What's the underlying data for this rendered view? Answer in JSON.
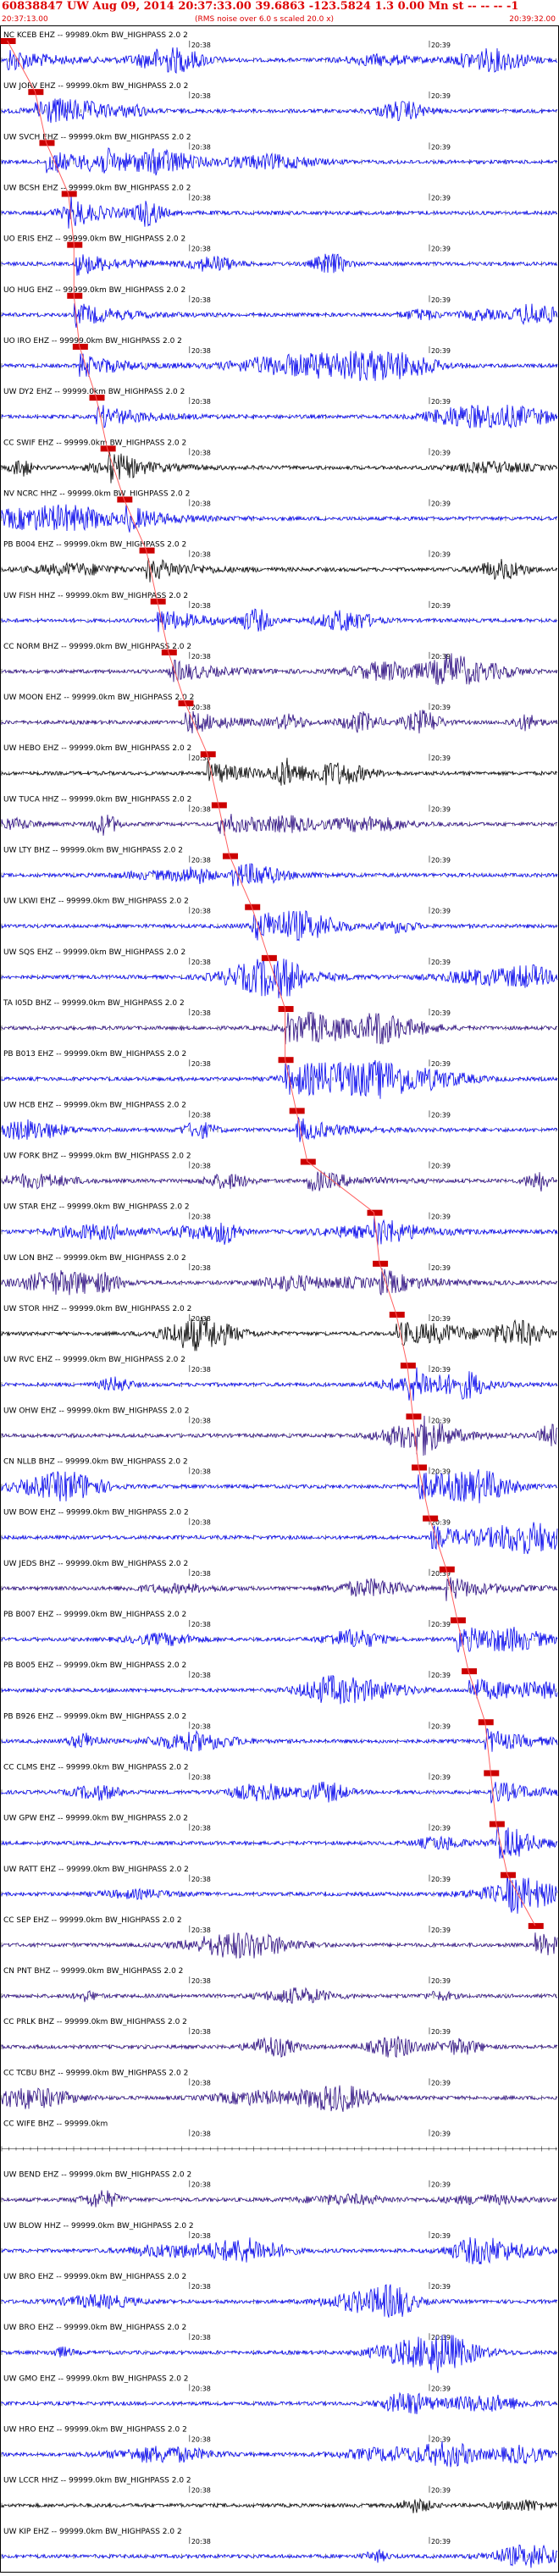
{
  "header": {
    "title": "60838847 UW Aug 09, 2014 20:37:33.00   39.6863 -123.5824  1.3 0.00 Mn st -- -- --  -1",
    "start_time": "20:37:13.00",
    "end_time": "20:39:32.00",
    "note": "(RMS noise over 6.0 s scaled 20.0 x)"
  },
  "colors": {
    "header_red": "#dd0000",
    "pick_red": "#cc0000",
    "pick_line": "#ff6060",
    "trace_blue": "#0000ee",
    "trace_purple": "#2a0a80",
    "trace_black": "#000000"
  },
  "chart_data": {
    "type": "seismogram",
    "time_window": [
      "20:37:13.00",
      "20:39:32.00"
    ],
    "minute_marks": [
      "20:38",
      "20:39"
    ],
    "channels": [
      {
        "label": "NC KCEB EHZ -- 99989.0km BW_HIGHPASS  2.0  2",
        "color": "blue",
        "pick": 0.01
      },
      {
        "label": "UW JORV EHZ -- 99999.0km BW_HIGHPASS  2.0  2",
        "color": "blue",
        "pick": 0.06
      },
      {
        "label": "UW SVCH EHZ -- 99999.0km BW_HIGHPASS  2.0  2",
        "color": "blue",
        "pick": 0.08
      },
      {
        "label": "UW BCSH EHZ -- 99999.0km BW_HIGHPASS  2.0  2",
        "color": "blue",
        "pick": 0.12
      },
      {
        "label": "UO ERIS EHZ -- 99999.0km BW_HIGHPASS  2.0  2",
        "color": "blue",
        "pick": 0.13
      },
      {
        "label": "UO HUG EHZ -- 99999.0km BW_HIGHPASS  2.0  2",
        "color": "blue",
        "pick": 0.13
      },
      {
        "label": "UO IRO EHZ -- 99999.0km BW_HIGHPASS  2.0  2",
        "color": "blue",
        "pick": 0.14
      },
      {
        "label": "UW DY2 EHZ -- 99999.0km BW_HIGHPASS  2.0  2",
        "color": "blue",
        "pick": 0.17
      },
      {
        "label": "CC SWIF EHZ -- 99999.0km BW_HIGHPASS  2.0  2",
        "color": "black",
        "pick": 0.19
      },
      {
        "label": "NV NCRC HHZ -- 99999.0km BW_HIGHPASS  2.0  2",
        "color": "blue",
        "pick": 0.22
      },
      {
        "label": "PB B004 EHZ -- 99999.0km BW_HIGHPASS  2.0  2",
        "color": "black",
        "pick": 0.26
      },
      {
        "label": "UW FISH HHZ -- 99999.0km BW_HIGHPASS  2.0  2",
        "color": "blue",
        "pick": 0.28
      },
      {
        "label": "CC NORM BHZ -- 99999.0km BW_HIGHPASS  2.0  2",
        "color": "purple",
        "pick": 0.3
      },
      {
        "label": "UW MOON EHZ -- 99999.0km BW_HIGHPASS  2.0  2",
        "color": "purple",
        "pick": 0.33
      },
      {
        "label": "UW HEBO EHZ -- 99999.0km BW_HIGHPASS  2.0  2",
        "color": "black",
        "pick": 0.37
      },
      {
        "label": "UW TUCA HHZ -- 99999.0km BW_HIGHPASS  2.0  2",
        "color": "purple",
        "pick": 0.39
      },
      {
        "label": "UW LTY BHZ -- 99999.0km BW_HIGHPASS  2.0  2",
        "color": "blue",
        "pick": 0.41
      },
      {
        "label": "UW LKWI EHZ -- 99999.0km BW_HIGHPASS  2.0  2",
        "color": "blue",
        "pick": 0.45
      },
      {
        "label": "UW SQS EHZ -- 99999.0km BW_HIGHPASS  2.0  2",
        "color": "blue",
        "pick": 0.48
      },
      {
        "label": "TA I05D BHZ -- 99999.0km BW_HIGHPASS  2.0  2",
        "color": "purple",
        "pick": 0.51
      },
      {
        "label": "PB B013 EHZ -- 99999.0km BW_HIGHPASS  2.0  2",
        "color": "blue",
        "pick": 0.51
      },
      {
        "label": "UW HCB EHZ -- 99999.0km BW_HIGHPASS  2.0  2",
        "color": "blue",
        "pick": 0.53
      },
      {
        "label": "UW FORK BHZ -- 99999.0km BW_HIGHPASS  2.0  2",
        "color": "purple",
        "pick": 0.55
      },
      {
        "label": "UW STAR EHZ -- 99999.0km BW_HIGHPASS  2.0  2",
        "color": "blue",
        "pick": 0.67
      },
      {
        "label": "UW LON BHZ -- 99999.0km BW_HIGHPASS  2.0  2",
        "color": "purple",
        "pick": 0.68
      },
      {
        "label": "UW STOR HHZ -- 99999.0km BW_HIGHPASS  2.0  2",
        "color": "black",
        "pick": 0.71
      },
      {
        "label": "UW RVC EHZ -- 99999.0km BW_HIGHPASS  2.0  2",
        "color": "blue",
        "pick": 0.73
      },
      {
        "label": "UW OHW EHZ -- 99999.0km BW_HIGHPASS  2.0  2",
        "color": "purple",
        "pick": 0.74
      },
      {
        "label": "CN NLLB BHZ -- 99999.0km BW_HIGHPASS  2.0  2",
        "color": "blue",
        "pick": 0.75
      },
      {
        "label": "UW BOW EHZ -- 99999.0km BW_HIGHPASS  2.0  2",
        "color": "blue",
        "pick": 0.77
      },
      {
        "label": "UW JEDS BHZ -- 99999.0km BW_HIGHPASS  2.0  2",
        "color": "purple",
        "pick": 0.8
      },
      {
        "label": "PB B007 EHZ -- 99999.0km BW_HIGHPASS  2.0  2",
        "color": "blue",
        "pick": 0.82
      },
      {
        "label": "PB B005 EHZ -- 99999.0km BW_HIGHPASS  2.0  2",
        "color": "blue",
        "pick": 0.84
      },
      {
        "label": "PB B926 EHZ -- 99999.0km BW_HIGHPASS  2.0  2",
        "color": "blue",
        "pick": 0.87
      },
      {
        "label": "CC CLMS EHZ -- 99999.0km BW_HIGHPASS  2.0  2",
        "color": "blue",
        "pick": 0.88
      },
      {
        "label": "UW GPW EHZ -- 99999.0km BW_HIGHPASS  2.0  2",
        "color": "blue",
        "pick": 0.89
      },
      {
        "label": "UW RATT EHZ -- 99999.0km BW_HIGHPASS  2.0  2",
        "color": "blue",
        "pick": 0.91
      },
      {
        "label": "CC SEP EHZ -- 99999.0km BW_HIGHPASS  2.0  2",
        "color": "purple",
        "pick": 0.96
      },
      {
        "label": "CN PNT BHZ -- 99999.0km BW_HIGHPASS  2.0  2",
        "color": "purple",
        "pick": null
      },
      {
        "label": "CC PRLK BHZ -- 99999.0km BW_HIGHPASS  2.0  2",
        "color": "purple",
        "pick": null
      },
      {
        "label": "CC TCBU BHZ -- 99999.0km BW_HIGHPASS  2.0  2",
        "color": "purple",
        "pick": null
      },
      {
        "label": "CC WIFE BHZ -- 99999.0km",
        "color": "none",
        "pick": null
      },
      {
        "label": "UW BEND EHZ -- 99999.0km BW_HIGHPASS  2.0  2",
        "color": "purple",
        "pick": null
      },
      {
        "label": "UW BLOW HHZ -- 99999.0km BW_HIGHPASS  2.0  2",
        "color": "blue",
        "pick": null
      },
      {
        "label": "UW BRO EHZ -- 99999.0km BW_HIGHPASS  2.0  2",
        "color": "blue",
        "pick": null
      },
      {
        "label": "UW BRO EHZ -- 99999.0km BW_HIGHPASS  2.0  2",
        "color": "blue",
        "pick": null
      },
      {
        "label": "UW GMO EHZ -- 99999.0km BW_HIGHPASS  2.0  2",
        "color": "blue",
        "pick": null
      },
      {
        "label": "UW HRO EHZ -- 99999.0km BW_HIGHPASS  2.0  2",
        "color": "blue",
        "pick": null
      },
      {
        "label": "UW LCCR HHZ -- 99999.0km BW_HIGHPASS  2.0  2",
        "color": "black",
        "pick": null
      },
      {
        "label": "UW KIP EHZ -- 99999.0km BW_HIGHPASS  2.0  2",
        "color": "blue",
        "pick": null
      }
    ]
  }
}
